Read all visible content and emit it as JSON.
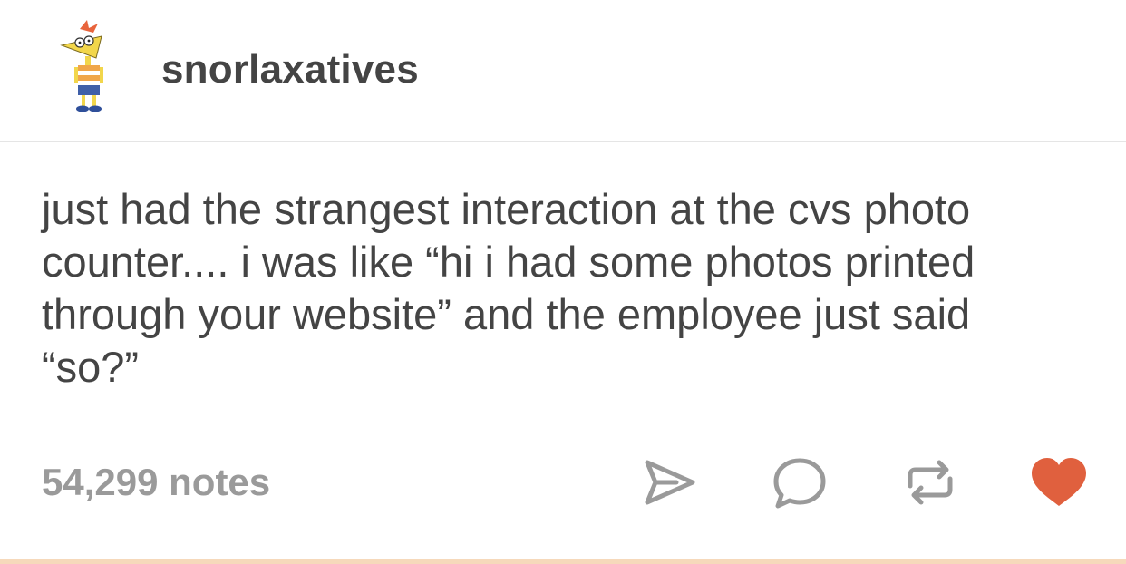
{
  "post": {
    "username": "snorlaxatives",
    "body": "just had the strangest interaction at the cvs photo counter.... i was like “hi i had some photos printed through your website” and the employee just said “so?”",
    "notes": "54,299 notes"
  },
  "actions": {
    "share_icon": "share-icon",
    "reply_icon": "reply-icon",
    "reblog_icon": "reblog-icon",
    "like_icon": "heart-icon",
    "liked": true
  },
  "colors": {
    "text": "#444444",
    "muted": "#9a9a9a",
    "heart": "#e0603e",
    "divider": "#e5e5e5",
    "bottom_bar": "#f6d9bb"
  }
}
